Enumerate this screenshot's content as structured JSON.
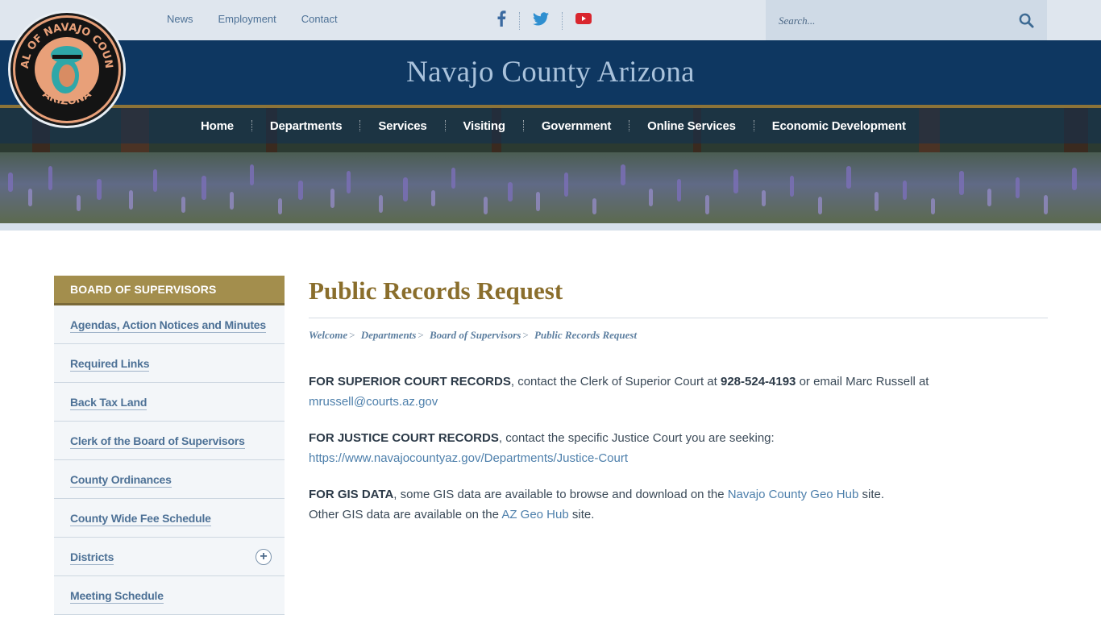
{
  "header": {
    "top_links": [
      "News",
      "Employment",
      "Contact"
    ],
    "social": [
      "facebook-icon",
      "twitter-icon",
      "youtube-icon"
    ],
    "search_placeholder": "Search...",
    "site_title": "Navajo County Arizona",
    "seal": {
      "top_text": "SEAL OF NAVAJO COUNTY",
      "bottom_text": "ARIZONA"
    }
  },
  "nav": {
    "items": [
      "Home",
      "Departments",
      "Services",
      "Visiting",
      "Government",
      "Online Services",
      "Economic Development"
    ]
  },
  "sidebar": {
    "heading": "BOARD OF SUPERVISORS",
    "items": [
      {
        "label": "Agendas, Action Notices and Minutes"
      },
      {
        "label": "Required Links"
      },
      {
        "label": "Back Tax Land"
      },
      {
        "label": "Clerk of the Board of Supervisors"
      },
      {
        "label": "County Ordinances"
      },
      {
        "label": "County Wide Fee Schedule"
      },
      {
        "label": "Districts",
        "expandable": true
      },
      {
        "label": "Meeting Schedule"
      }
    ]
  },
  "main": {
    "title": "Public Records Request",
    "breadcrumb": [
      "Welcome",
      "Departments",
      "Board of Supervisors",
      "Public Records Request"
    ],
    "p1": {
      "bold": "FOR SUPERIOR COURT RECORDS",
      "text": ", contact the Clerk of Superior Court at ",
      "phone": "928-524-4193",
      "text2": " or email Marc Russell at ",
      "email": "mrussell@courts.az.gov"
    },
    "p2": {
      "bold": "FOR JUSTICE COURT RECORDS",
      "text": ", contact the specific Justice Court you are seeking:",
      "link": "https://www.navajocountyaz.gov/Departments/Justice-Court"
    },
    "p3": {
      "bold": "FOR GIS DATA",
      "text": ", some GIS data are available to browse and download on the ",
      "link1": "Navajo County Geo Hub",
      "text2": " site.",
      "line2": "Other GIS data are available on the ",
      "link2": "AZ Geo Hub",
      "text3": " site."
    }
  },
  "colors": {
    "navy": "#0e3761",
    "gold": "#a38e4d",
    "link": "#4d7196",
    "title_gold": "#8a6e2c"
  }
}
